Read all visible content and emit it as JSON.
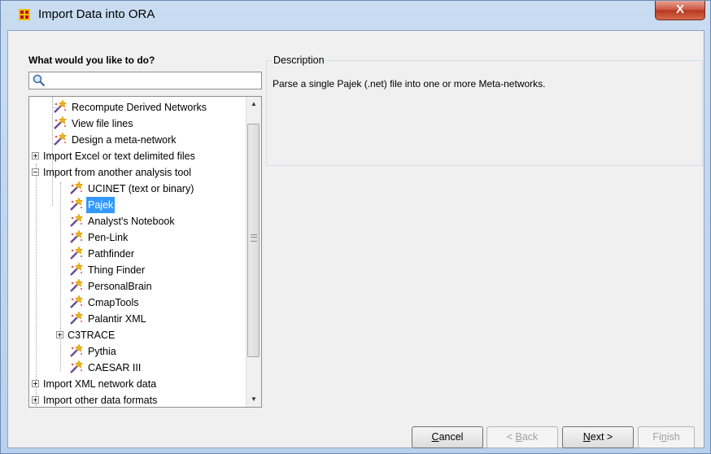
{
  "window": {
    "title": "Import Data into ORA",
    "close_label": "X"
  },
  "left_panel": {
    "heading": "What would you like to do?",
    "search": {
      "value": "",
      "placeholder": ""
    }
  },
  "tree": {
    "items": [
      {
        "label": "Recompute Derived Networks",
        "type": "leaf"
      },
      {
        "label": "View file lines",
        "type": "leaf"
      },
      {
        "label": "Design a meta-network",
        "type": "leaf"
      },
      {
        "label": "Import Excel or text delimited files",
        "type": "collapsed"
      },
      {
        "label": "Import from another analysis tool",
        "type": "expanded"
      },
      {
        "label": "UCINET (text or binary)",
        "type": "leaf"
      },
      {
        "label": "Pajek",
        "type": "leaf",
        "selected": true
      },
      {
        "label": "Analyst's Notebook",
        "type": "leaf"
      },
      {
        "label": "Pen-Link",
        "type": "leaf"
      },
      {
        "label": "Pathfinder",
        "type": "leaf"
      },
      {
        "label": "Thing Finder",
        "type": "leaf"
      },
      {
        "label": "PersonalBrain",
        "type": "leaf"
      },
      {
        "label": "CmapTools",
        "type": "leaf"
      },
      {
        "label": "Palantir XML",
        "type": "leaf"
      },
      {
        "label": "C3TRACE",
        "type": "collapsed"
      },
      {
        "label": "Pythia",
        "type": "leaf"
      },
      {
        "label": "CAESAR III",
        "type": "leaf"
      },
      {
        "label": "Import XML network data",
        "type": "collapsed"
      },
      {
        "label": "Import other data formats",
        "type": "collapsed"
      }
    ]
  },
  "description": {
    "legend": "Description",
    "text": "Parse a single Pajek (.net) file into one or more Meta-networks."
  },
  "buttons": {
    "cancel": {
      "prefix": "",
      "mnemonic": "C",
      "rest": "ancel"
    },
    "back": {
      "prefix": "< ",
      "mnemonic": "B",
      "rest": "ack"
    },
    "next": {
      "prefix": "",
      "mnemonic": "N",
      "rest": "ext >"
    },
    "finish": {
      "prefix": "Fi",
      "mnemonic": "n",
      "rest": "ish"
    }
  },
  "colors": {
    "selection": "#3399ff",
    "title_bar": "#c9dcf1",
    "close_button": "#c9503c"
  }
}
